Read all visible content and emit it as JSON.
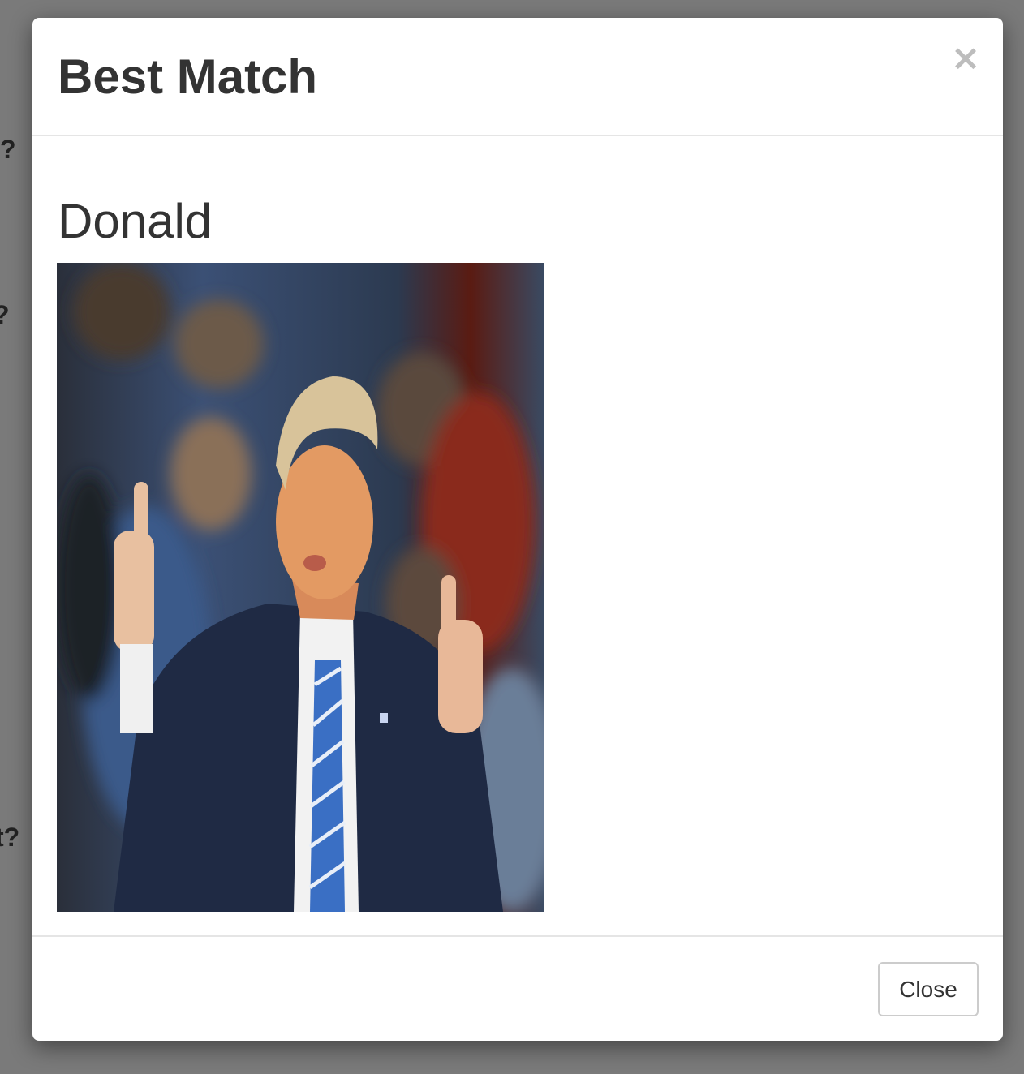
{
  "background": {
    "fragments": [
      "?",
      "?",
      "t?"
    ]
  },
  "modal": {
    "title": "Best Match",
    "close_icon": "×",
    "match_name": "Donald",
    "photo_description_icon": "person-photo",
    "close_label": "Close"
  },
  "colors": {
    "backdrop": "#7a7a7a",
    "modal_bg": "#ffffff",
    "title_text": "#333333",
    "divider": "#e5e5e5",
    "button_border": "#cccccc"
  }
}
